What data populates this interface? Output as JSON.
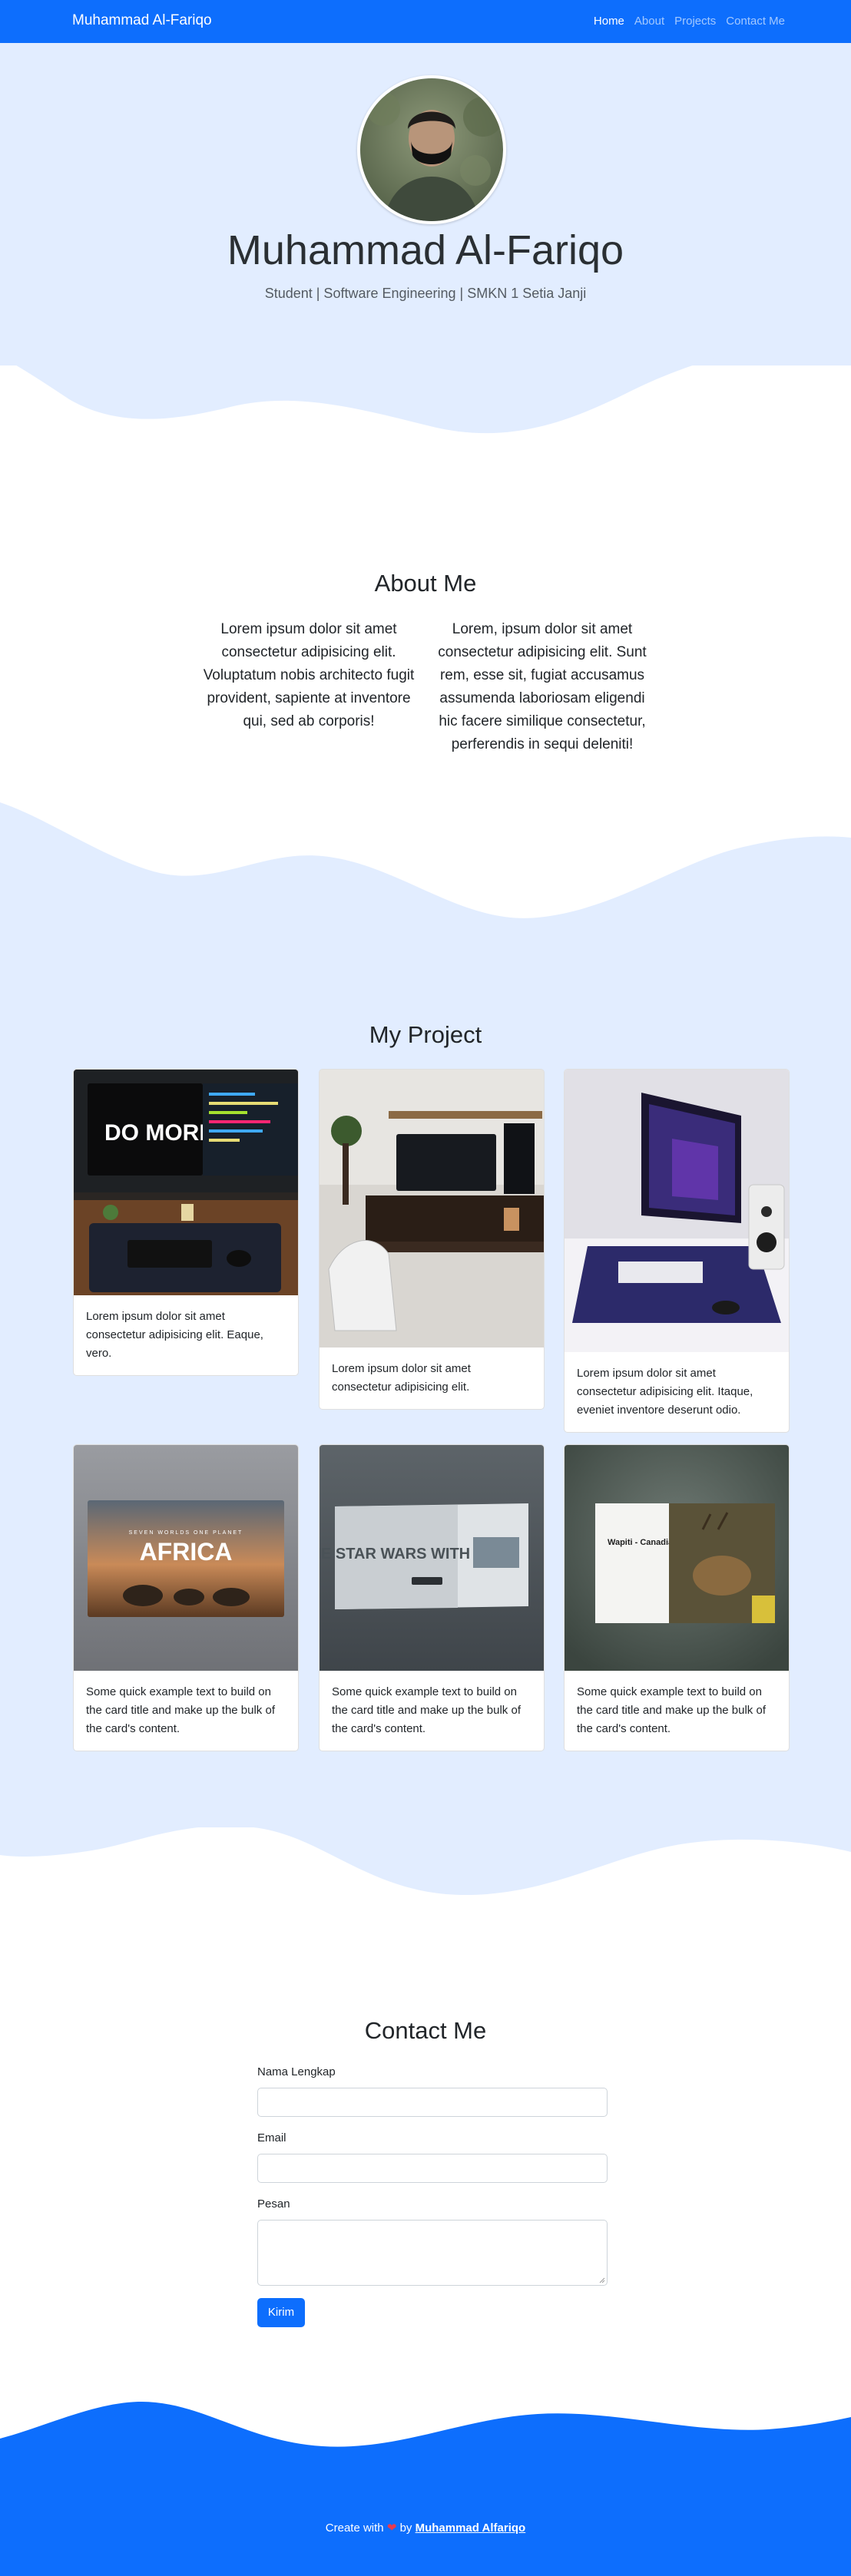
{
  "navbar": {
    "brand": "Muhammad Al-Fariqo",
    "links": [
      "Home",
      "About",
      "Projects",
      "Contact Me"
    ]
  },
  "hero": {
    "name": "Muhammad Al-Fariqo",
    "subtitle": "Student | Software Engineering | SMKN 1 Setia Janji"
  },
  "about": {
    "title": "About Me",
    "col1": "Lorem ipsum dolor sit amet consectetur adipisicing elit. Voluptatum nobis architecto fugit provident, sapiente at inventore qui, sed ab corporis!",
    "col2": "Lorem, ipsum dolor sit amet consectetur adipisicing elit. Sunt rem, esse sit, fugiat accusamus assumenda laboriosam eligendi hic facere similique consectetur, perferendis in sequi deleniti!"
  },
  "projects": {
    "title": "My Project",
    "cards": [
      {
        "text": "Lorem ipsum dolor sit amet consectetur adipisicing elit. Eaque, vero."
      },
      {
        "text": "Lorem ipsum dolor sit amet consectetur adipisicing elit."
      },
      {
        "text": "Lorem ipsum dolor sit amet consectetur adipisicing elit. Itaque, eveniet inventore deserunt odio."
      },
      {
        "text": "Some quick example text to build on the card title and make up the bulk of the card's content."
      },
      {
        "text": "Some quick example text to build on the card title and make up the bulk of the card's content."
      },
      {
        "text": "Some quick example text to build on the card title and make up the bulk of the card's content."
      }
    ],
    "image_overlay": {
      "do_more": "DO MORI",
      "africa_small": "SEVEN WORLDS ONE PLANET",
      "africa": "AFRICA",
      "star_wars": "THE STAR WARS WITH YOU",
      "wapiti": "Wapiti - Canadian Deer"
    }
  },
  "contact": {
    "title": "Contact Me",
    "name_label": "Nama Lengkap",
    "email_label": "Email",
    "message_label": "Pesan",
    "submit": "Kirim"
  },
  "footer": {
    "prefix": "Create with",
    "heart": "❤",
    "by": "by",
    "author": "Muhammad Alfariqo"
  },
  "colors": {
    "primary": "#0d6efd",
    "light_blue": "#e2edff"
  },
  "icons": {
    "heart": "heart-icon"
  }
}
